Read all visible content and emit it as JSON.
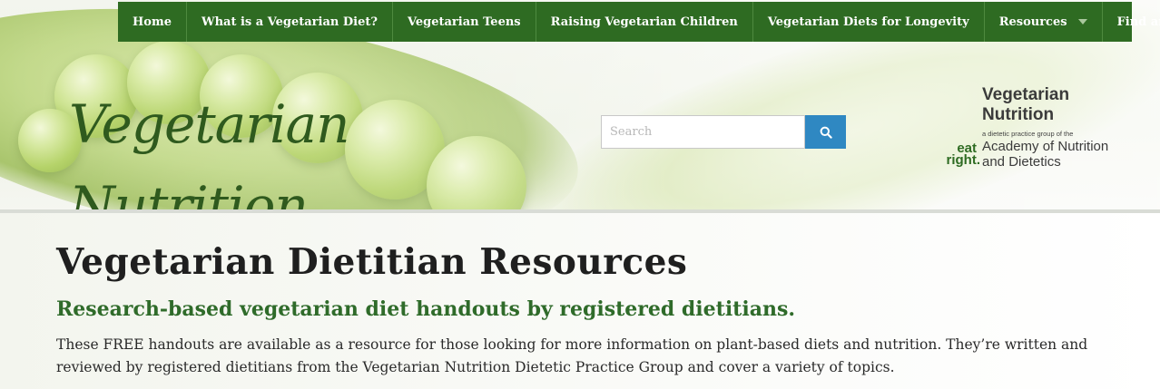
{
  "nav": {
    "items": [
      {
        "label": "Home"
      },
      {
        "label": "What is a Vegetarian Diet?"
      },
      {
        "label": "Vegetarian Teens"
      },
      {
        "label": "Raising Vegetarian Children"
      },
      {
        "label": "Vegetarian Diets for Longevity"
      },
      {
        "label": "Resources",
        "has_dropdown": true
      },
      {
        "label": "Find an RD"
      }
    ]
  },
  "header": {
    "site_logo": "Vegetarian Nutrition",
    "search": {
      "placeholder": "Search",
      "button_icon": "search-icon"
    },
    "org_logo": {
      "title_line1": "Vegetarian",
      "title_line2": "Nutrition",
      "tagline": "a dietetic practice group of the",
      "academy_line1": "Academy of Nutrition",
      "academy_line2": "and Dietetics",
      "eat": "eat",
      "right": "right."
    }
  },
  "main": {
    "title": "Vegetarian Dietitian Resources",
    "subtitle": "Research-based vegetarian diet handouts by registered dietitians.",
    "body": "These FREE handouts are available as a resource for those looking for more information on plant-based diets and nutrition. They’re written and reviewed by registered dietitians from the Vegetarian Nutrition Dietetic Practice Group and cover a variety of topics."
  },
  "colors": {
    "nav_bg": "#2e6b22",
    "subtitle": "#2f6b2a",
    "search_button": "#2f88c2"
  }
}
